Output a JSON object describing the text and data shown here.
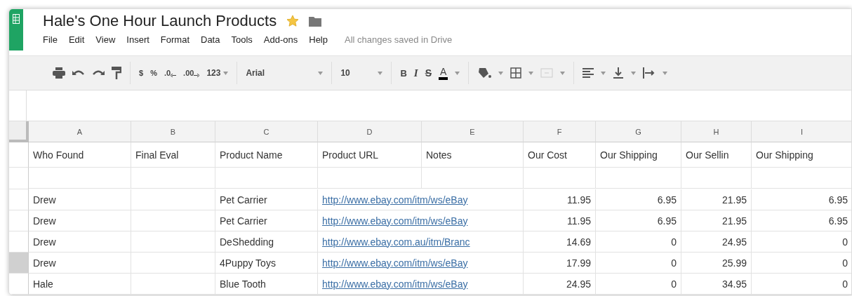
{
  "document": {
    "title": "Hale's One Hour Launch Products",
    "starred": true
  },
  "menu": [
    "File",
    "Edit",
    "View",
    "Insert",
    "Format",
    "Data",
    "Tools",
    "Add-ons",
    "Help"
  ],
  "save_status": "All changes saved in Drive",
  "toolbar": {
    "currency": "$",
    "percent": "%",
    "decrease_decimals": ".0",
    "increase_decimals": ".00",
    "more_formats": "123",
    "font": "Arial",
    "font_size": "10",
    "bold": "B",
    "italic": "I",
    "strikethrough": "S",
    "text_color": "A"
  },
  "columns": [
    "A",
    "B",
    "C",
    "D",
    "E",
    "F",
    "G",
    "H",
    "I"
  ],
  "header_row": [
    "Who Found",
    "Final Eval",
    "Product Name",
    "Product URL",
    "Notes",
    "Our Cost",
    "Our Shipping",
    "Our Sellin",
    "Our Shipping"
  ],
  "rows": [
    {
      "who": "Drew",
      "name": "Pet Carrier",
      "url": "http://www.ebay.com/itm/ws/eBay",
      "values": [
        "11.95",
        "6.95",
        "21.95",
        "6.95"
      ],
      "selected": false
    },
    {
      "who": "Drew",
      "name": "Pet Carrier",
      "url": "http://www.ebay.com/itm/ws/eBay",
      "values": [
        "11.95",
        "6.95",
        "21.95",
        "6.95"
      ],
      "selected": false
    },
    {
      "who": "Drew",
      "name": "DeShedding",
      "url": "http://www.ebay.com.au/itm/Branc",
      "values": [
        "14.69",
        "0",
        "24.95",
        "0"
      ],
      "selected": false
    },
    {
      "who": "Drew",
      "name": "4Puppy Toys",
      "url": "http://www.ebay.com/itm/ws/eBay",
      "values": [
        "17.99",
        "0",
        "25.99",
        "0"
      ],
      "selected": true
    },
    {
      "who": "Hale",
      "name": "Blue Tooth",
      "url": "http://www.ebay.com/itm/ws/eBay",
      "values": [
        "24.95",
        "0",
        "34.95",
        "0"
      ],
      "selected": false
    }
  ]
}
